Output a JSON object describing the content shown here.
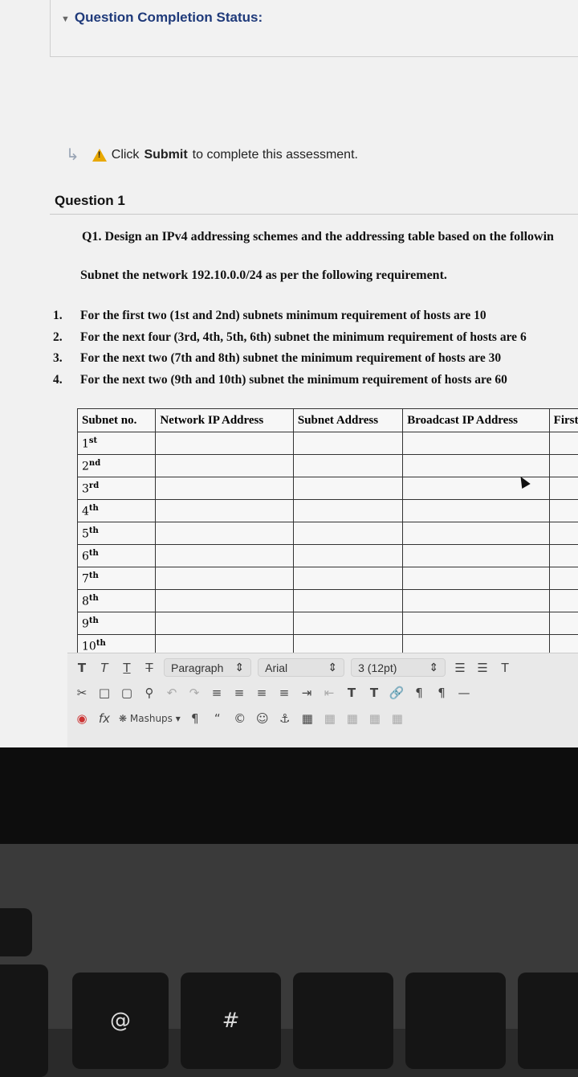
{
  "status": {
    "title": "Question Completion Status:"
  },
  "notice": {
    "prefix": "Click",
    "action": "Submit",
    "suffix": "to complete this assessment."
  },
  "question": {
    "title": "Question 1",
    "prompt": "Q1. Design an IPv4 addressing schemes and the addressing table based on the followin",
    "network_line": "Subnet the network 192.10.0.0/24 as per the following requirement.",
    "requirements": [
      {
        "num": "1.",
        "text": "For the first two (1st and 2nd) subnets minimum requirement of hosts are 10"
      },
      {
        "num": "2.",
        "text": "For the next four (3rd, 4th, 5th, 6th) subnet the minimum requirement of hosts are 6"
      },
      {
        "num": "3.",
        "text": "For the next two (7th and 8th) subnet the minimum requirement of hosts are 30"
      },
      {
        "num": "4.",
        "text": "For the next two (9th and 10th) subnet the minimum requirement of hosts are 60"
      }
    ]
  },
  "table": {
    "headers": [
      "Subnet no.",
      "Network IP Address",
      "Subnet Address",
      "Broadcast IP Address",
      "First"
    ],
    "rows": [
      {
        "n": "1",
        "sup": "st"
      },
      {
        "n": "2",
        "sup": "nd"
      },
      {
        "n": "3",
        "sup": "rd"
      },
      {
        "n": "4",
        "sup": "th"
      },
      {
        "n": "5",
        "sup": "th"
      },
      {
        "n": "6",
        "sup": "th"
      },
      {
        "n": "7",
        "sup": "th"
      },
      {
        "n": "8",
        "sup": "th"
      },
      {
        "n": "9",
        "sup": "th"
      },
      {
        "n": "10",
        "sup": "th"
      }
    ]
  },
  "editor": {
    "paragraph": "Paragraph",
    "font": "Arial",
    "size": "3 (12pt)",
    "mashups": "Mashups",
    "fx": "fx"
  },
  "keyboard": {
    "key_at": "@",
    "key_hash": "#"
  },
  "colors": {
    "status_title": "#1f3a7a",
    "warning": "#e8a800"
  }
}
